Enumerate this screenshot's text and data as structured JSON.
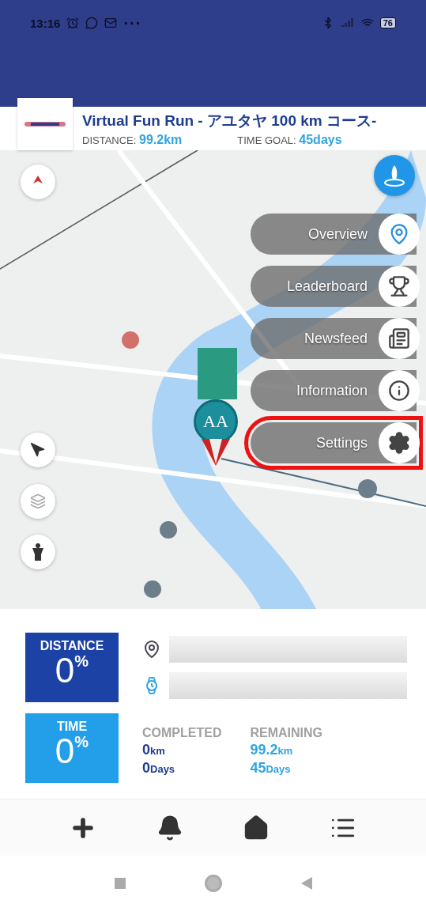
{
  "status_bar": {
    "time": "13:16",
    "more": "···",
    "battery": "76"
  },
  "course": {
    "title": "Virtual Fun Run - アユタヤ 100 km コース-",
    "distance_label": "DISTANCE:",
    "distance_value": "99.2",
    "distance_unit": "km",
    "goal_label": "TIME GOAL:",
    "goal_value": "45",
    "goal_unit": "days"
  },
  "marker": {
    "initials": "AA"
  },
  "menu": [
    {
      "label": "Overview",
      "kind": "route",
      "highlighted": false
    },
    {
      "label": "Leaderboard",
      "kind": "trophy",
      "highlighted": false
    },
    {
      "label": "Newsfeed",
      "kind": "news",
      "highlighted": false
    },
    {
      "label": "Information",
      "kind": "info",
      "highlighted": false
    },
    {
      "label": "Settings",
      "kind": "gear",
      "highlighted": true
    }
  ],
  "stats": {
    "tiles": [
      {
        "label": "DISTANCE",
        "value": "0",
        "unit": "%",
        "kind": "distance"
      },
      {
        "label": "TIME",
        "value": "0",
        "unit": "%",
        "kind": "time"
      }
    ],
    "bars": [
      {
        "kind": "distance",
        "level": 0
      },
      {
        "kind": "time",
        "level": 0
      }
    ],
    "columns": [
      {
        "heading": "COMPLETED",
        "kind": "completed",
        "lines": [
          {
            "value": "0",
            "unit": "km"
          },
          {
            "value": "0",
            "unit": "Days"
          }
        ]
      },
      {
        "heading": "REMAINING",
        "kind": "remaining",
        "lines": [
          {
            "value": "99.2",
            "unit": "km"
          },
          {
            "value": "45",
            "unit": "Days"
          }
        ]
      }
    ]
  },
  "bottom_nav": [
    {
      "kind": "add"
    },
    {
      "kind": "bell"
    },
    {
      "kind": "home"
    },
    {
      "kind": "list"
    }
  ]
}
